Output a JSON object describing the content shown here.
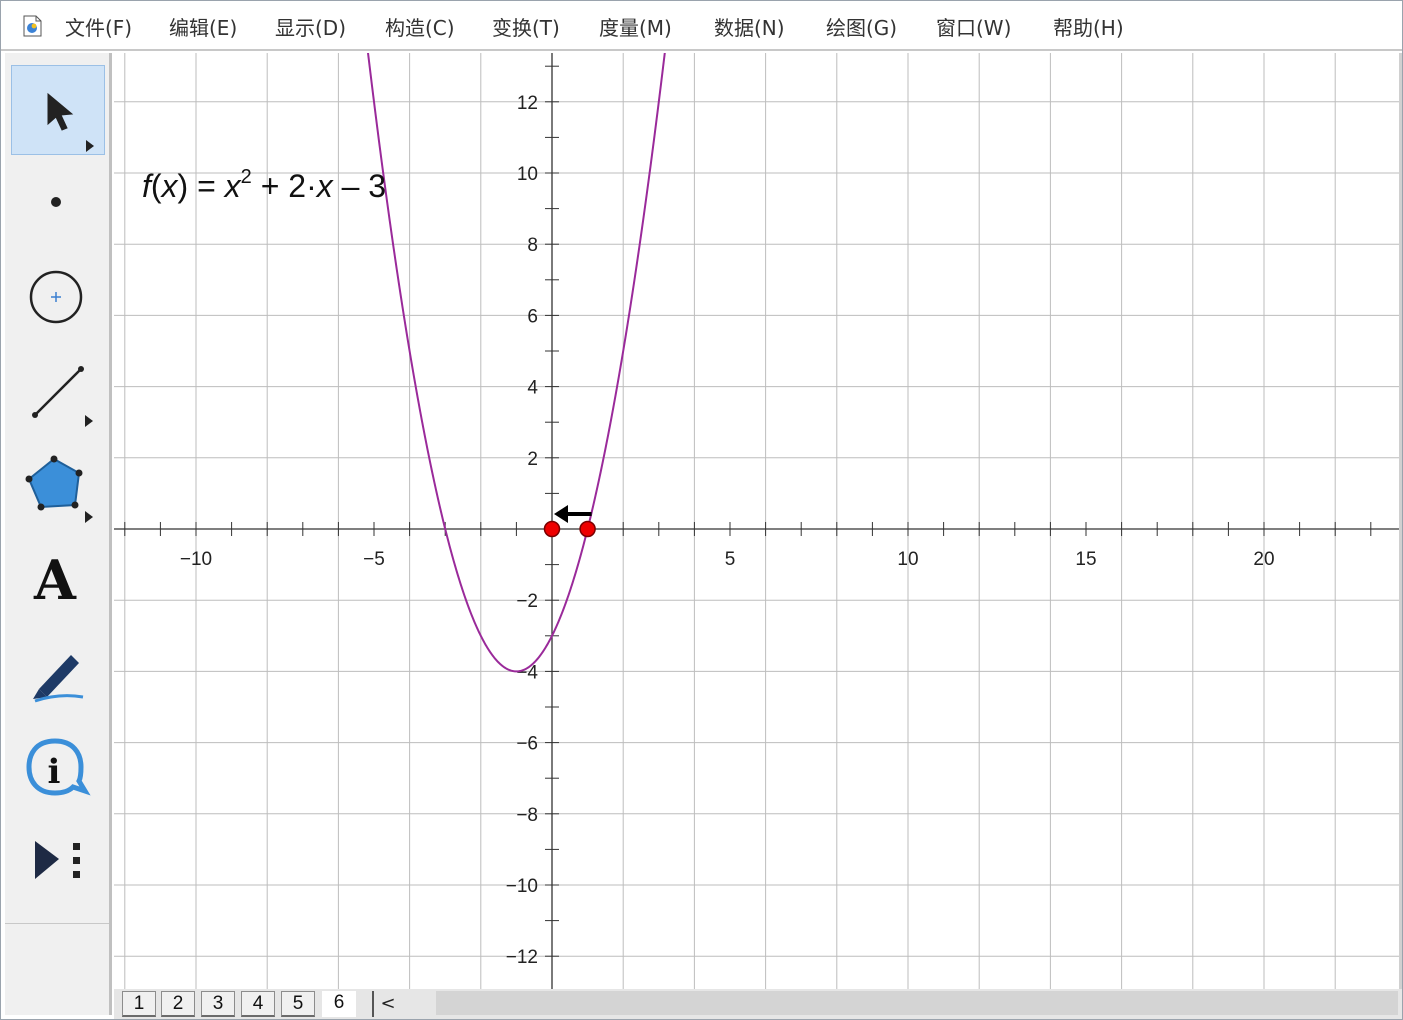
{
  "menubar": {
    "items": [
      {
        "label": "文件(F)"
      },
      {
        "label": "编辑(E)"
      },
      {
        "label": "显示(D)"
      },
      {
        "label": "构造(C)"
      },
      {
        "label": "变换(T)"
      },
      {
        "label": "度量(M)"
      },
      {
        "label": "数据(N)"
      },
      {
        "label": "绘图(G)"
      },
      {
        "label": "窗口(W)"
      },
      {
        "label": "帮助(H)"
      }
    ]
  },
  "toolbox": {
    "tools": [
      {
        "icon": "arrow-select-icon",
        "selected": true
      },
      {
        "icon": "point-icon"
      },
      {
        "icon": "compass-circle-icon"
      },
      {
        "icon": "straightedge-icon"
      },
      {
        "icon": "polygon-icon"
      },
      {
        "icon": "text-icon",
        "glyph": "A"
      },
      {
        "icon": "marker-icon"
      },
      {
        "icon": "information-icon",
        "glyph": "i"
      },
      {
        "icon": "custom-tool-icon"
      }
    ]
  },
  "graph": {
    "formula": {
      "f": "f",
      "open": "(",
      "x": "x",
      "close": ")",
      "eq": " = ",
      "x2": "x",
      "exp": "2",
      "rest1": " + 2·",
      "x3": "x",
      "rest2": " – 3"
    },
    "function": {
      "a": 1,
      "b": 2,
      "c": -3
    },
    "curve_color": "#9a2a9a",
    "x_ticks": [
      -10,
      -5,
      5,
      10,
      15,
      20
    ],
    "y_ticks": [
      12,
      10,
      8,
      6,
      4,
      2,
      -2,
      -4,
      -6,
      -8,
      -10,
      -12
    ],
    "points": [
      {
        "x": 0,
        "y": 0,
        "color": "#ee0000"
      },
      {
        "x": 1,
        "y": 0,
        "color": "#ee0000"
      }
    ]
  },
  "pages": {
    "tabs": [
      "1",
      "2",
      "3",
      "4",
      "5",
      "6"
    ],
    "active": "6",
    "scroll_left": "<"
  }
}
